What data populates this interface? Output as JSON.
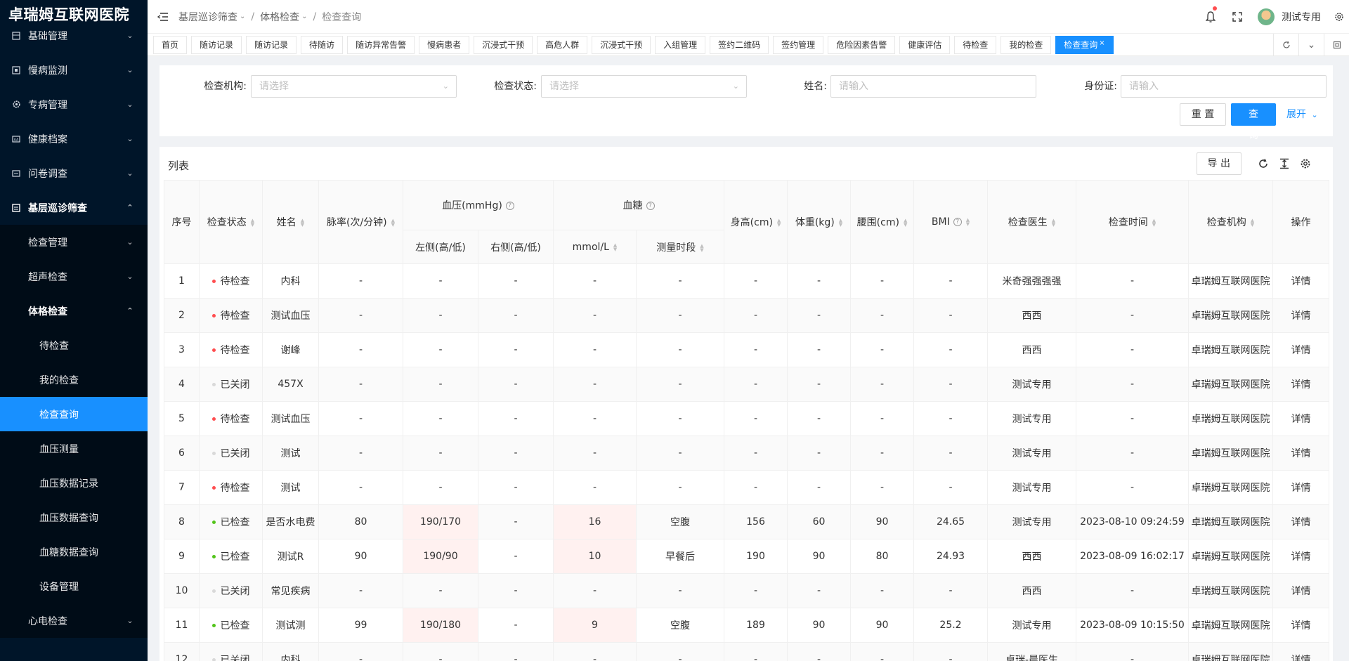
{
  "app": {
    "title": "卓瑞姆互联网医院"
  },
  "sidebar": {
    "items": [
      {
        "label": "基础管理",
        "icon": "grid-icon"
      },
      {
        "label": "慢病监测",
        "icon": "monitor-icon"
      },
      {
        "label": "专病管理",
        "icon": "settings-icon"
      },
      {
        "label": "健康档案",
        "icon": "file-icon"
      },
      {
        "label": "问卷调查",
        "icon": "survey-icon"
      },
      {
        "label": "基层巡诊筛查",
        "icon": "screening-icon"
      }
    ],
    "sub": [
      {
        "label": "检查管理"
      },
      {
        "label": "超声检查"
      },
      {
        "label": "体格检查"
      }
    ],
    "subsub": [
      {
        "label": "待检查"
      },
      {
        "label": "我的检查"
      },
      {
        "label": "检查查询"
      },
      {
        "label": "血压测量"
      },
      {
        "label": "血压数据记录"
      },
      {
        "label": "血压数据查询"
      },
      {
        "label": "血糖数据查询"
      },
      {
        "label": "设备管理"
      }
    ],
    "after": [
      {
        "label": "心电检查"
      }
    ]
  },
  "header": {
    "breadcrumb": [
      "基层巡诊筛查",
      "体格检查",
      "检查查询"
    ],
    "username": "测试专用"
  },
  "tabs": [
    "首页",
    "随访记录",
    "随访记录",
    "待随访",
    "随访异常告警",
    "慢病患者",
    "沉浸式干预",
    "高危人群",
    "沉浸式干预",
    "入组管理",
    "签约二维码",
    "签约管理",
    "危险因素告警",
    "健康评估",
    "待检查",
    "我的检查",
    "检查查询"
  ],
  "filter": {
    "org_label": "检查机构:",
    "org_placeholder": "请选择",
    "status_label": "检查状态:",
    "status_placeholder": "请选择",
    "name_label": "姓名:",
    "name_placeholder": "请输入",
    "id_label": "身份证:",
    "id_placeholder": "请输入",
    "reset": "重 置",
    "search": "查 询",
    "expand": "展开"
  },
  "list": {
    "title": "列表",
    "export": "导 出",
    "headers": {
      "index": "序号",
      "status": "检查状态",
      "name": "姓名",
      "pulse": "脉率(次/分钟)",
      "bp": "血压(mmHg)",
      "bp_left": "左侧(高/低)",
      "bp_right": "右侧(高/低)",
      "glucose": "血糖",
      "glucose_unit": "mmol/L",
      "glucose_period": "测量时段",
      "height": "身高(cm)",
      "weight": "体重(kg)",
      "waist": "腰围(cm)",
      "bmi": "BMI",
      "doctor": "检查医生",
      "time": "检查时间",
      "org": "检查机构",
      "op": "操作"
    },
    "rows": [
      {
        "index": "1",
        "status": "待检查",
        "status_color": "red",
        "name": "内科",
        "pulse": "-",
        "bp_left": "-",
        "bp_right": "-",
        "glucose": "-",
        "period": "-",
        "height": "-",
        "weight": "-",
        "waist": "-",
        "bmi": "-",
        "doctor": "米奇强强强强",
        "time": "-",
        "org": "卓瑞姆互联网医院",
        "op": "详情"
      },
      {
        "index": "2",
        "status": "待检查",
        "status_color": "red",
        "name": "测试血压",
        "pulse": "-",
        "bp_left": "-",
        "bp_right": "-",
        "glucose": "-",
        "period": "-",
        "height": "-",
        "weight": "-",
        "waist": "-",
        "bmi": "-",
        "doctor": "西西",
        "time": "-",
        "org": "卓瑞姆互联网医院",
        "op": "详情"
      },
      {
        "index": "3",
        "status": "待检查",
        "status_color": "red",
        "name": "谢峰",
        "pulse": "-",
        "bp_left": "-",
        "bp_right": "-",
        "glucose": "-",
        "period": "-",
        "height": "-",
        "weight": "-",
        "waist": "-",
        "bmi": "-",
        "doctor": "西西",
        "time": "-",
        "org": "卓瑞姆互联网医院",
        "op": "详情"
      },
      {
        "index": "4",
        "status": "已关闭",
        "status_color": "grey",
        "name": "457X",
        "pulse": "-",
        "bp_left": "-",
        "bp_right": "-",
        "glucose": "-",
        "period": "-",
        "height": "-",
        "weight": "-",
        "waist": "-",
        "bmi": "-",
        "doctor": "测试专用",
        "time": "-",
        "org": "卓瑞姆互联网医院",
        "op": "详情"
      },
      {
        "index": "5",
        "status": "待检查",
        "status_color": "red",
        "name": "测试血压",
        "pulse": "-",
        "bp_left": "-",
        "bp_right": "-",
        "glucose": "-",
        "period": "-",
        "height": "-",
        "weight": "-",
        "waist": "-",
        "bmi": "-",
        "doctor": "测试专用",
        "time": "-",
        "org": "卓瑞姆互联网医院",
        "op": "详情"
      },
      {
        "index": "6",
        "status": "已关闭",
        "status_color": "grey",
        "name": "测试",
        "pulse": "-",
        "bp_left": "-",
        "bp_right": "-",
        "glucose": "-",
        "period": "-",
        "height": "-",
        "weight": "-",
        "waist": "-",
        "bmi": "-",
        "doctor": "测试专用",
        "time": "-",
        "org": "卓瑞姆互联网医院",
        "op": "详情"
      },
      {
        "index": "7",
        "status": "待检查",
        "status_color": "red",
        "name": "测试",
        "pulse": "-",
        "bp_left": "-",
        "bp_right": "-",
        "glucose": "-",
        "period": "-",
        "height": "-",
        "weight": "-",
        "waist": "-",
        "bmi": "-",
        "doctor": "测试专用",
        "time": "-",
        "org": "卓瑞姆互联网医院",
        "op": "详情"
      },
      {
        "index": "8",
        "status": "已检查",
        "status_color": "green",
        "name": "是否水电费",
        "pulse": "80",
        "bp_left": "190/170",
        "bp_right": "-",
        "glucose": "16",
        "period": "空腹",
        "height": "156",
        "weight": "60",
        "waist": "90",
        "bmi": "24.65",
        "doctor": "测试专用",
        "time": "2023-08-10 09:24:59",
        "org": "卓瑞姆互联网医院",
        "op": "详情"
      },
      {
        "index": "9",
        "status": "已检查",
        "status_color": "green",
        "name": "测试R",
        "pulse": "90",
        "bp_left": "190/90",
        "bp_right": "-",
        "glucose": "10",
        "period": "早餐后",
        "height": "190",
        "weight": "90",
        "waist": "80",
        "bmi": "24.93",
        "doctor": "西西",
        "time": "2023-08-09 16:02:17",
        "org": "卓瑞姆互联网医院",
        "op": "详情"
      },
      {
        "index": "10",
        "status": "已关闭",
        "status_color": "grey",
        "name": "常见疾病",
        "pulse": "-",
        "bp_left": "-",
        "bp_right": "-",
        "glucose": "-",
        "period": "-",
        "height": "-",
        "weight": "-",
        "waist": "-",
        "bmi": "-",
        "doctor": "西西",
        "time": "-",
        "org": "卓瑞姆互联网医院",
        "op": "详情"
      },
      {
        "index": "11",
        "status": "已检查",
        "status_color": "green",
        "name": "测试测",
        "pulse": "99",
        "bp_left": "190/180",
        "bp_right": "-",
        "glucose": "9",
        "period": "空腹",
        "height": "189",
        "weight": "90",
        "waist": "90",
        "bmi": "25.2",
        "doctor": "测试专用",
        "time": "2023-08-09 10:15:50",
        "org": "卓瑞姆互联网医院",
        "op": "详情"
      },
      {
        "index": "12",
        "status": "已关闭",
        "status_color": "grey",
        "name": "内科",
        "pulse": "-",
        "bp_left": "-",
        "bp_right": "-",
        "glucose": "-",
        "period": "-",
        "height": "-",
        "weight": "-",
        "waist": "-",
        "bmi": "-",
        "doctor": "卓瑞-晨医生",
        "time": "-",
        "org": "卓瑞姆互联网医院",
        "op": "详情"
      }
    ]
  },
  "colors": {
    "primary": "#1890ff",
    "sidebar": "#001529",
    "alarm_bg": "#fff1f0",
    "alarm_text": "#f5222d",
    "bmi_text": "#fa8c16"
  }
}
